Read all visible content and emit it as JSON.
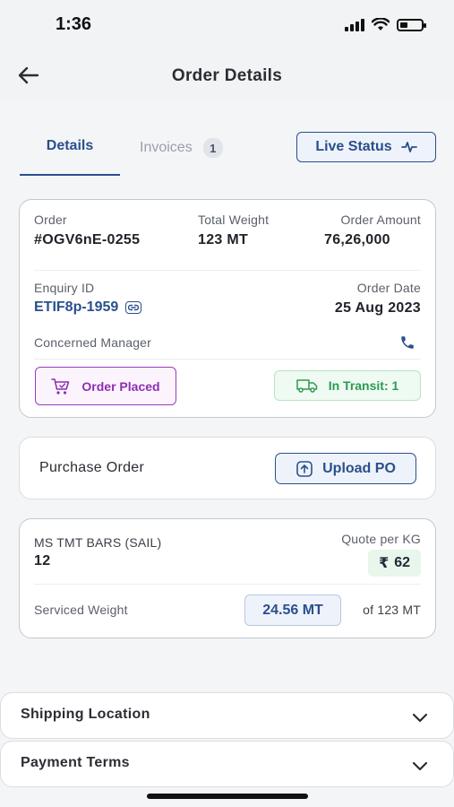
{
  "status_bar": {
    "time": "1:36",
    "battery_level": 0.35
  },
  "header": {
    "title": "Order Details"
  },
  "tabs": {
    "details": "Details",
    "invoices": "Invoices",
    "invoice_count": "1",
    "live_status": "Live Status"
  },
  "order_card": {
    "order_label": "Order",
    "order_value": "#OGV6nE-0255",
    "weight_label": "Total Weight",
    "weight_value": "123 MT",
    "amount_label": "Order Amount",
    "amount_value": "76,26,000",
    "enquiry_label": "Enquiry ID",
    "enquiry_value": "ETIF8p-1959",
    "date_label": "Order Date",
    "date_value": "25 Aug 2023",
    "manager_label": "Concerned Manager",
    "status_placed": "Order Placed",
    "status_transit": "In Transit: 1"
  },
  "purchase_order": {
    "label": "Purchase Order",
    "upload_label": "Upload PO"
  },
  "product_card": {
    "name": "MS TMT BARS (SAIL)",
    "quantity": "12",
    "quote_label": "Quote per KG",
    "currency": "₹",
    "quote_value": "62",
    "serviced_label": "Serviced Weight",
    "serviced_value": "24.56 MT",
    "total_text": "of 123 MT"
  },
  "accordions": {
    "shipping": "Shipping Location",
    "payment": "Payment Terms"
  },
  "colors": {
    "primary": "#2a4f8c",
    "placed": "#8d2eb3",
    "transit": "#2f9a52"
  }
}
